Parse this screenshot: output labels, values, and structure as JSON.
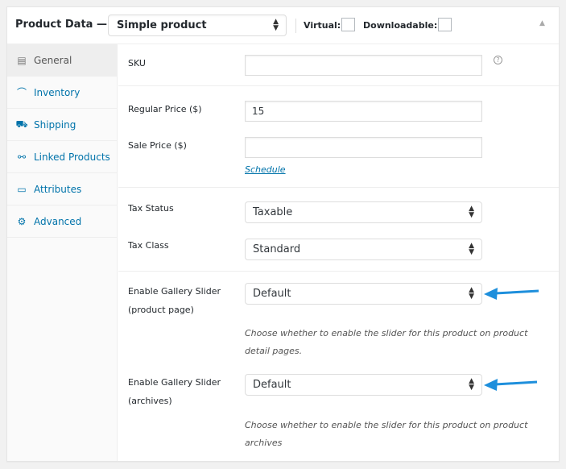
{
  "header": {
    "title": "Product Data —",
    "product_type": "Simple product",
    "virtual_label": "Virtual:",
    "virtual_checked": false,
    "downloadable_label": "Downloadable:",
    "downloadable_checked": false,
    "arrows_up": "▲",
    "arrows_down": "▼",
    "collapse_icon": "▲"
  },
  "sidebar": {
    "items": [
      {
        "label": "General",
        "icon": "▤",
        "icon_name": "general-icon",
        "active": true
      },
      {
        "label": "Inventory",
        "icon": "⌒",
        "icon_name": "inventory-icon",
        "active": false
      },
      {
        "label": "Shipping",
        "icon": "⛟",
        "icon_name": "shipping-icon",
        "active": false
      },
      {
        "label": "Linked Products",
        "icon": "⚯",
        "icon_name": "link-icon",
        "active": false
      },
      {
        "label": "Attributes",
        "icon": "▭",
        "icon_name": "attributes-icon",
        "active": false
      },
      {
        "label": "Advanced",
        "icon": "⚙",
        "icon_name": "gear-icon",
        "active": false
      }
    ]
  },
  "general": {
    "sku_label": "SKU",
    "sku_value": "",
    "help_icon": "?",
    "regular_price_label": "Regular Price ($)",
    "regular_price_value": "15",
    "sale_price_label": "Sale Price ($)",
    "sale_price_value": "",
    "schedule_link": "Schedule",
    "tax_status_label": "Tax Status",
    "tax_status_value": "Taxable",
    "tax_class_label": "Tax Class",
    "tax_class_value": "Standard",
    "slider_product_label_1": "Enable Gallery Slider",
    "slider_product_label_2": "(product page)",
    "slider_product_value": "Default",
    "slider_product_desc_1": "Choose whether to enable the slider for this product on product",
    "slider_product_desc_2": "detail pages.",
    "slider_archive_label_1": "Enable Gallery Slider",
    "slider_archive_label_2": "(archives)",
    "slider_archive_value": "Default",
    "slider_archive_desc_1": "Choose whether to enable the slider for this product on product",
    "slider_archive_desc_2": "archives"
  },
  "annotations": {
    "arrow_color": "#1e8fdc"
  },
  "colors": {
    "link": "#0073aa",
    "text": "#23282d"
  }
}
